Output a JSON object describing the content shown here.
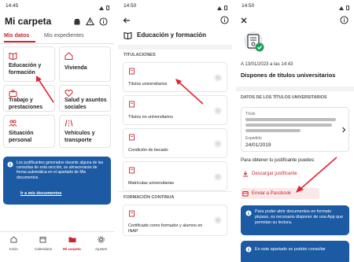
{
  "screen1": {
    "time": "14:45",
    "title": "Mi carpeta",
    "tabs": [
      {
        "label": "Mis datos",
        "active": true
      },
      {
        "label": "Mis expedientes",
        "active": false
      }
    ],
    "tiles": [
      {
        "label": "Educación y formación",
        "icon": "book-icon"
      },
      {
        "label": "Vivienda",
        "icon": "house-icon"
      },
      {
        "label": "Trabajo y prestaciones",
        "icon": "briefcase-icon"
      },
      {
        "label": "Salud y asuntos sociales",
        "icon": "heart-icon"
      },
      {
        "label": "Situación personal",
        "icon": "people-icon"
      },
      {
        "label": "Vehículos y transporte",
        "icon": "road-icon"
      }
    ],
    "info_text": "Los justificantes generados durante alguna de las consultas de esta sección, se almacenarán de forma automática en el apartado de Mis documentos.",
    "info_link": "Ir a mis documentos",
    "nav": [
      {
        "label": "Inicio",
        "icon": "home-icon",
        "active": false
      },
      {
        "label": "Calendario",
        "icon": "calendar-icon",
        "active": false
      },
      {
        "label": "Mi carpeta",
        "icon": "folder-icon",
        "active": true
      },
      {
        "label": "Ajustes",
        "icon": "gear-icon",
        "active": false
      }
    ],
    "accent": "#c8242c",
    "info_bg": "#1c5aa3"
  },
  "screen2": {
    "time": "14:50",
    "title": "Educación y formación",
    "section1": "TITULACIONES",
    "rows1": [
      "Títulos universitarios",
      "Títulos no universitarios",
      "Condición de becado",
      "Matrículas universitarias"
    ],
    "section2": "FORMACIÓN CONTINUA",
    "rows2": [
      "Certificado como formador y alumno en INAP"
    ]
  },
  "screen3": {
    "time": "14:50",
    "date_line": "A 13/01/2023 a las 14:43",
    "headline": "Dispones de títulos universitarios",
    "section": "DATOS DE LOS TÍTULOS UNIVERSITARIOS",
    "field1_label": "Título",
    "field2_label": "Expedido",
    "field2_value": "24/01/2019",
    "prompt": "Para obtener tu justificante puedes:",
    "btn_download": "Descargar justificante",
    "btn_passbook": "Enviar a Passbook",
    "info1": "Para poder abrir documentos en formato pkpass, es necesario disponer de una App que permitan su lectura.",
    "info2": "En este apartado se podrán consultar"
  }
}
